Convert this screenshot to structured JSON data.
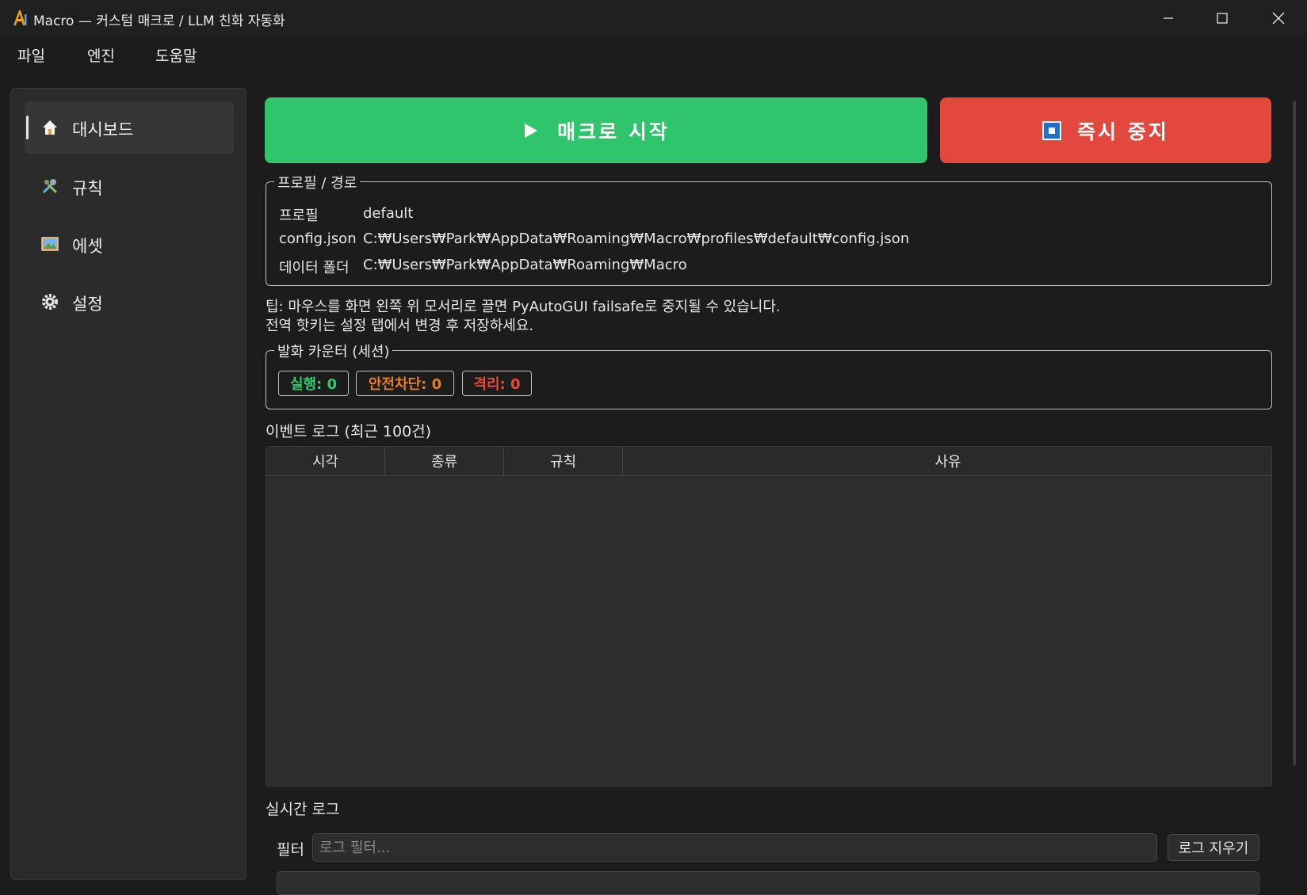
{
  "window": {
    "title": "Macro — 커스텀 매크로 / LLM 친화 자동화",
    "minimize_icon": "minimize-icon",
    "maximize_icon": "maximize-icon",
    "close_icon": "close-icon"
  },
  "menu": [
    "파일",
    "엔진",
    "도움말"
  ],
  "sidebar": {
    "items": [
      {
        "label": "대시보드",
        "icon": "home-icon",
        "active": true
      },
      {
        "label": "규칙",
        "icon": "tools-icon",
        "active": false
      },
      {
        "label": "에셋",
        "icon": "image-icon",
        "active": false
      },
      {
        "label": "설정",
        "icon": "gear-icon",
        "active": false
      }
    ]
  },
  "actions": {
    "start_label": "매크로 시작",
    "stop_label": "즉시 중지",
    "start_color": "#2fc56c",
    "stop_color": "#e2483c"
  },
  "profile_group": {
    "title": "프로필 / 경로",
    "rows": [
      {
        "key": "프로필",
        "value": "default"
      },
      {
        "key": "config.json",
        "value": "C:₩Users₩Park₩AppData₩Roaming₩Macro₩profiles₩default₩config.json"
      },
      {
        "key": "데이터 폴더",
        "value": "C:₩Users₩Park₩AppData₩Roaming₩Macro"
      }
    ]
  },
  "tips": [
    "팁: 마우스를 화면 왼쪽 위 모서리로 끌면 PyAutoGUI failsafe로 중지될 수 있습니다.",
    "전역 핫키는 설정 탭에서 변경 후 저장하세요."
  ],
  "counter_group": {
    "title": "발화 카운터 (세션)",
    "badges": [
      {
        "label": "실행: 0",
        "color": "#2ecc71"
      },
      {
        "label": "안전차단: 0",
        "color": "#e67e22"
      },
      {
        "label": "격리: 0",
        "color": "#e74c3c"
      }
    ]
  },
  "event_log": {
    "title": "이벤트 로그 (최근 100건)",
    "columns": [
      "시각",
      "종류",
      "규칙",
      "사유"
    ],
    "rows": []
  },
  "live_log": {
    "title": "실시간 로그",
    "filter_label": "필터",
    "filter_placeholder": "로그 필터...",
    "filter_value": "",
    "clear_label": "로그 지우기"
  }
}
